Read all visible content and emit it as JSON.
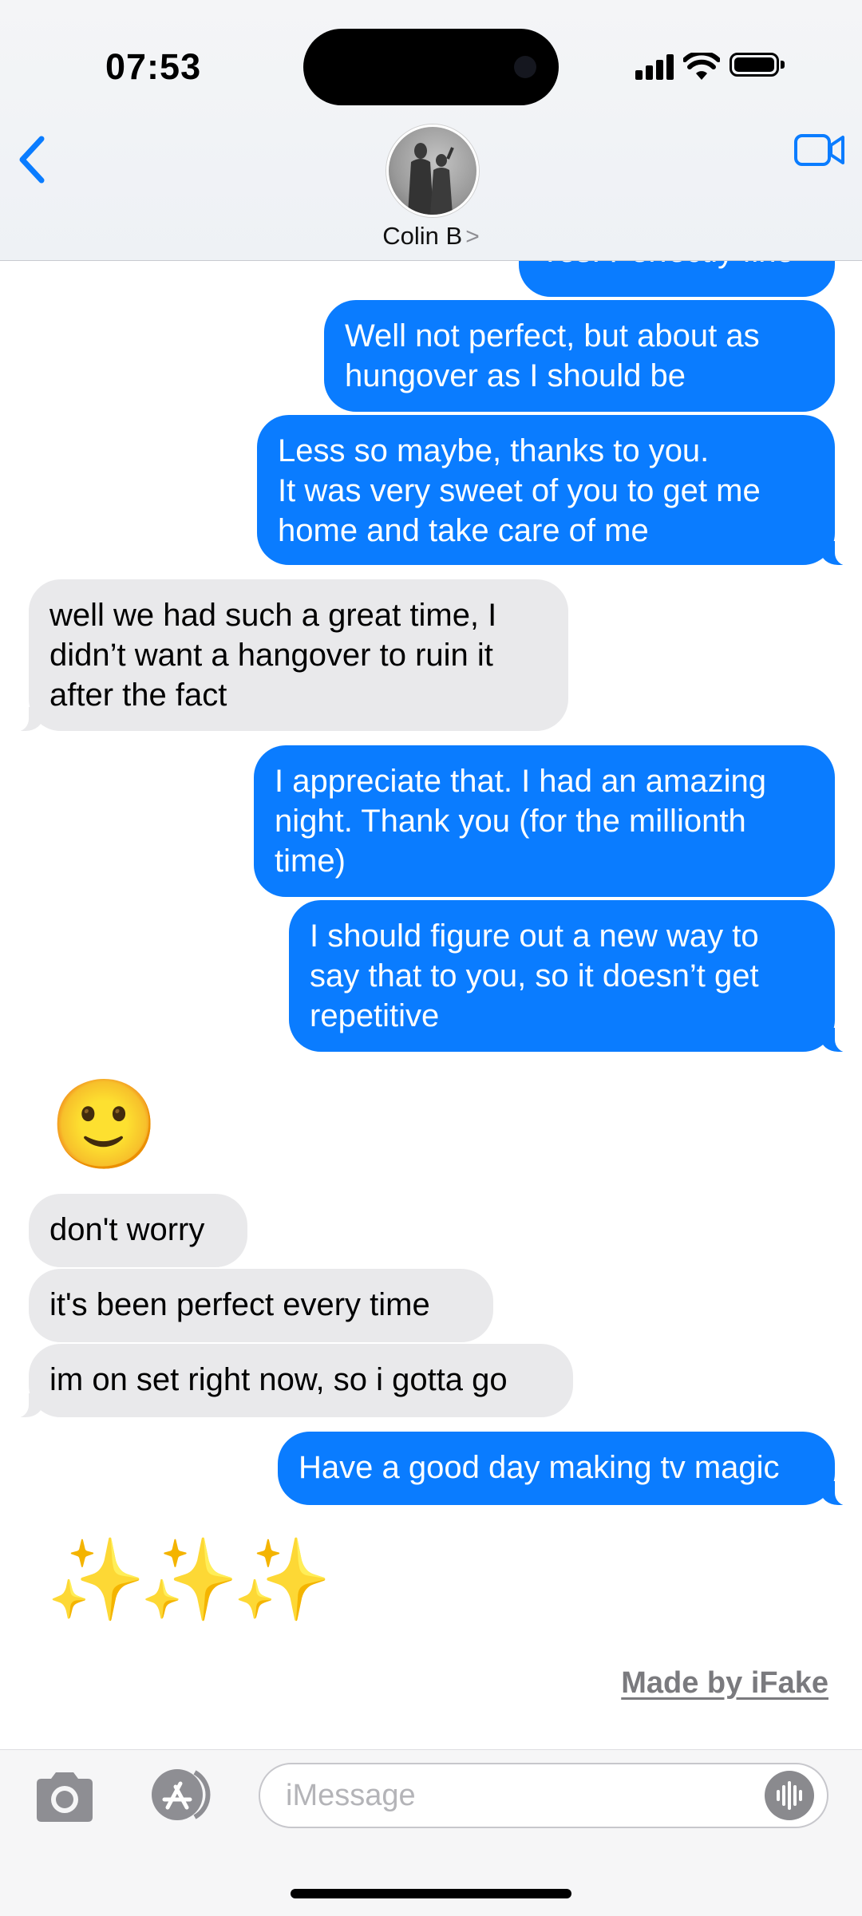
{
  "status_bar": {
    "time": "07:53"
  },
  "header": {
    "contact_name": "Colin B",
    "chevron": ">"
  },
  "messages": [
    {
      "from": "me",
      "text": "Yes. Perfectly fine"
    },
    {
      "from": "me",
      "text": "Well not perfect, but about as\nhungover as I should be"
    },
    {
      "from": "me",
      "text": "Less so maybe, thanks to you.\nIt was very sweet of you to get me\nhome and take care of me"
    },
    {
      "from": "them",
      "text": "well we had such a great time, I\ndidn’t want a hangover to ruin it\nafter the fact"
    },
    {
      "from": "me",
      "text": "I appreciate that. I had an amazing\nnight. Thank you (for the millionth\ntime)"
    },
    {
      "from": "me",
      "text": "I should figure out a new way to\nsay that to you, so it doesn’t get\nrepetitive"
    },
    {
      "from": "them",
      "text": "🙂"
    },
    {
      "from": "them",
      "text": "don't worry"
    },
    {
      "from": "them",
      "text": "it's been perfect every time"
    },
    {
      "from": "them",
      "text": "im on set right now, so i gotta go"
    },
    {
      "from": "me",
      "text": "Have a good day making tv magic"
    },
    {
      "from": "them",
      "text": "✨✨✨"
    }
  ],
  "watermark": "Made by iFake",
  "composer": {
    "placeholder": "iMessage",
    "value": ""
  },
  "colors": {
    "sent_bubble": "#0a7cff",
    "received_bubble": "#e9e9eb",
    "accent": "#0a7cff"
  }
}
